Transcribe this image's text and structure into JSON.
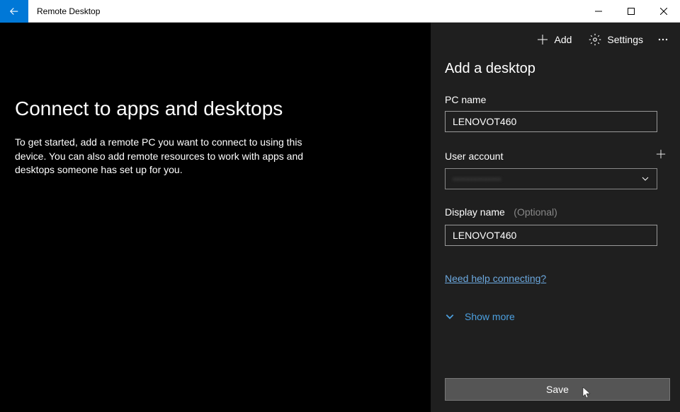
{
  "window": {
    "title": "Remote Desktop"
  },
  "toolbar": {
    "add": "Add",
    "settings": "Settings"
  },
  "main": {
    "title": "Connect to apps and desktops",
    "description": "To get started, add a remote PC you want to connect to using this device. You can also add remote resources to work with apps and desktops someone has set up for you."
  },
  "panel": {
    "title": "Add a desktop",
    "pc_name_label": "PC name",
    "pc_name_value": "LENOVOT460",
    "user_account_label": "User account",
    "user_account_value": "••••••••••••••",
    "display_name_label": "Display name",
    "display_name_optional": "(Optional)",
    "display_name_value": "LENOVOT460",
    "help_link": "Need help connecting?",
    "show_more": "Show more",
    "save_button": "Save"
  }
}
